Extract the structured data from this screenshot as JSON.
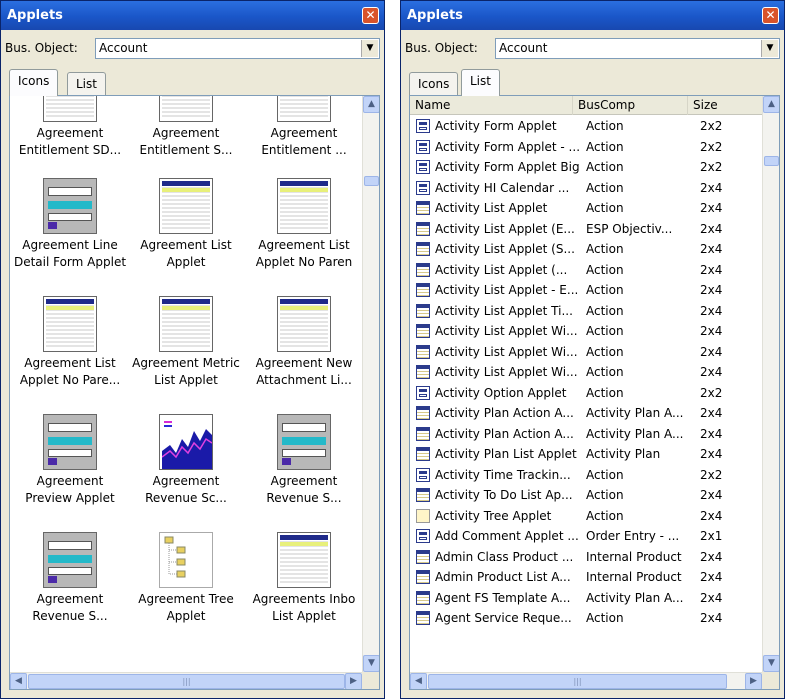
{
  "left": {
    "title": "Applets",
    "bus_label": "Bus. Object:",
    "bus_value": "Account",
    "tabs": [
      "Icons",
      "List"
    ],
    "icons": [
      {
        "l1": "Agreement",
        "l2": "Entitlement SD...",
        "kind": "list"
      },
      {
        "l1": "Agreement",
        "l2": "Entitlement S...",
        "kind": "list"
      },
      {
        "l1": "Agreement",
        "l2": "Entitlement ...",
        "kind": "list"
      },
      {
        "l1": "Agreement Line",
        "l2": "Detail Form Applet",
        "kind": "form"
      },
      {
        "l1": "Agreement List",
        "l2": "Applet",
        "kind": "list"
      },
      {
        "l1": "Agreement List",
        "l2": "Applet No Paren",
        "kind": "list"
      },
      {
        "l1": "Agreement List",
        "l2": "Applet No Pare...",
        "kind": "list"
      },
      {
        "l1": "Agreement Metric",
        "l2": "List Applet",
        "kind": "list"
      },
      {
        "l1": "Agreement New",
        "l2": "Attachment Li...",
        "kind": "list"
      },
      {
        "l1": "Agreement",
        "l2": "Preview Applet",
        "kind": "form"
      },
      {
        "l1": "Agreement",
        "l2": "Revenue Sc...",
        "kind": "chart"
      },
      {
        "l1": "Agreement",
        "l2": "Revenue S...",
        "kind": "form"
      },
      {
        "l1": "Agreement",
        "l2": "Revenue S...",
        "kind": "form"
      },
      {
        "l1": "Agreement Tree",
        "l2": "Applet",
        "kind": "tree"
      },
      {
        "l1": "Agreements Inbo",
        "l2": "List Applet",
        "kind": "list"
      }
    ]
  },
  "right": {
    "title": "Applets",
    "bus_label": "Bus. Object:",
    "bus_value": "Account",
    "tabs": [
      "Icons",
      "List"
    ],
    "columns": [
      "Name",
      "BusComp",
      "Size"
    ],
    "rows": [
      {
        "icon": "form",
        "name": "Activity Form Applet",
        "buscomp": "Action",
        "size": "2x2"
      },
      {
        "icon": "form",
        "name": "Activity Form Applet - ...",
        "buscomp": "Action",
        "size": "2x2"
      },
      {
        "icon": "form",
        "name": "Activity Form Applet Big",
        "buscomp": "Action",
        "size": "2x2"
      },
      {
        "icon": "form",
        "name": "Activity HI Calendar ...",
        "buscomp": "Action",
        "size": "2x4"
      },
      {
        "icon": "list",
        "name": "Activity List Applet",
        "buscomp": "Action",
        "size": "2x4"
      },
      {
        "icon": "list",
        "name": "Activity List Applet (E...",
        "buscomp": "ESP Objectiv...",
        "size": "2x4"
      },
      {
        "icon": "list",
        "name": "Activity List Applet (S...",
        "buscomp": "Action",
        "size": "2x4"
      },
      {
        "icon": "list",
        "name": "Activity List Applet (...",
        "buscomp": "Action",
        "size": "2x4"
      },
      {
        "icon": "list",
        "name": "Activity List Applet - E...",
        "buscomp": "Action",
        "size": "2x4"
      },
      {
        "icon": "list",
        "name": "Activity List Applet Ti...",
        "buscomp": "Action",
        "size": "2x4"
      },
      {
        "icon": "list",
        "name": "Activity List Applet Wi...",
        "buscomp": "Action",
        "size": "2x4"
      },
      {
        "icon": "list",
        "name": "Activity List Applet Wi...",
        "buscomp": "Action",
        "size": "2x4"
      },
      {
        "icon": "list",
        "name": "Activity List Applet Wi...",
        "buscomp": "Action",
        "size": "2x4"
      },
      {
        "icon": "form",
        "name": "Activity Option Applet",
        "buscomp": "Action",
        "size": "2x2"
      },
      {
        "icon": "list",
        "name": "Activity Plan Action A...",
        "buscomp": "Activity Plan A...",
        "size": "2x4"
      },
      {
        "icon": "list",
        "name": "Activity Plan Action A...",
        "buscomp": "Activity Plan A...",
        "size": "2x4"
      },
      {
        "icon": "list",
        "name": "Activity Plan List Applet",
        "buscomp": "Activity Plan",
        "size": "2x4"
      },
      {
        "icon": "form",
        "name": "Activity Time Trackin...",
        "buscomp": "Action",
        "size": "2x2"
      },
      {
        "icon": "list",
        "name": "Activity To Do List Ap...",
        "buscomp": "Action",
        "size": "2x4"
      },
      {
        "icon": "tree",
        "name": "Activity Tree Applet",
        "buscomp": "Action",
        "size": "2x4"
      },
      {
        "icon": "form",
        "name": "Add Comment Applet ...",
        "buscomp": "Order Entry - ...",
        "size": "2x1"
      },
      {
        "icon": "list",
        "name": "Admin Class Product ...",
        "buscomp": "Internal Product",
        "size": "2x4"
      },
      {
        "icon": "list",
        "name": "Admin Product List A...",
        "buscomp": "Internal Product",
        "size": "2x4"
      },
      {
        "icon": "list",
        "name": "Agent FS Template A...",
        "buscomp": "Activity Plan A...",
        "size": "2x4"
      },
      {
        "icon": "list",
        "name": "Agent Service Reque...",
        "buscomp": "Action",
        "size": "2x4"
      }
    ]
  },
  "scroll": {
    "up": "▲",
    "down": "▼",
    "left": "◀",
    "right": "▶",
    "grip": "|||"
  },
  "close_glyph": "✕",
  "combo_glyph": "▼"
}
